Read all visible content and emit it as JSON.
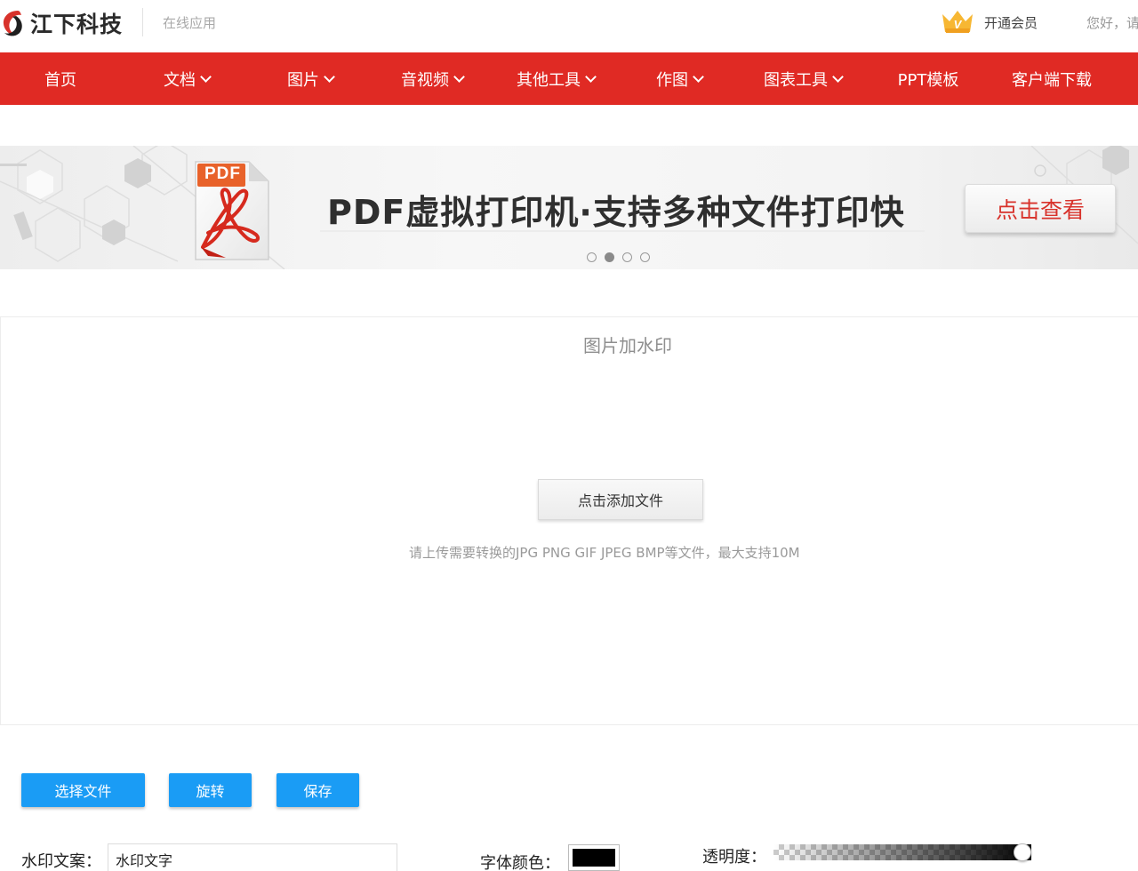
{
  "header": {
    "logo_text": "江下科技",
    "subtitle": "在线应用",
    "vip_label": "开通会员",
    "greeting": "您好，请"
  },
  "nav": {
    "items": [
      {
        "label": "首页",
        "dropdown": false
      },
      {
        "label": "文档",
        "dropdown": true
      },
      {
        "label": "图片",
        "dropdown": true
      },
      {
        "label": "音视频",
        "dropdown": true
      },
      {
        "label": "其他工具",
        "dropdown": true
      },
      {
        "label": "作图",
        "dropdown": true
      },
      {
        "label": "图表工具",
        "dropdown": true
      },
      {
        "label": "PPT模板",
        "dropdown": false
      },
      {
        "label": "客户端下载",
        "dropdown": false
      }
    ]
  },
  "banner": {
    "icon_label": "PDF",
    "text": "PDF虚拟打印机·支持多种文件打印快",
    "button_label": "点击查看",
    "dots_count": 4,
    "active_dot": 2
  },
  "upload": {
    "title": "图片加水印",
    "add_button_label": "点击添加文件",
    "hint": "请上传需要转换的JPG PNG GIF JPEG BMP等文件，最大支持10M"
  },
  "toolbar": {
    "select_file_label": "选择文件",
    "rotate_label": "旋转",
    "save_label": "保存"
  },
  "form": {
    "watermark_label": "水印文案：",
    "watermark_value": "水印文字",
    "font_color_label": "字体颜色：",
    "font_color_value": "#000000",
    "opacity_label": "透明度：",
    "opacity_value": 1.0
  },
  "colors": {
    "nav_red": "#e02a24",
    "button_blue": "#1a9cf5",
    "banner_button_text": "#d8322b",
    "vip_gold": "#f5a623"
  }
}
